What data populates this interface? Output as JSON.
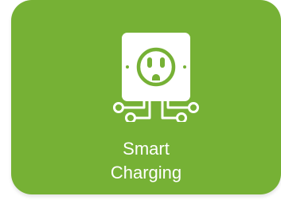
{
  "tile": {
    "label_line1": "Smart",
    "label_line2": "Charging",
    "icon": "smart-outlet-circuit-icon",
    "colors": {
      "background": "#76b135",
      "foreground": "#ffffff"
    }
  }
}
